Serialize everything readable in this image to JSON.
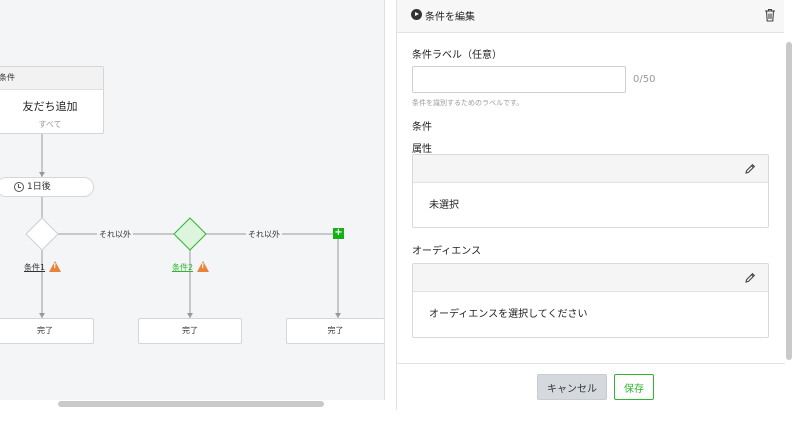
{
  "flow": {
    "trigger_header": "条件",
    "trigger_title": "友だち追加",
    "trigger_sub": "すべて",
    "delay_label": "1日後",
    "else_label_1": "それ以外",
    "else_label_2": "それ以外",
    "condition_1": "条件1",
    "condition_2": "条件2",
    "done_1": "完了",
    "done_2": "完了",
    "done_3": "完了",
    "plus_symbol": "+"
  },
  "panel": {
    "title": "条件を編集",
    "label_field_title": "条件ラベル（任意）",
    "label_value": "",
    "label_counter": "0/50",
    "label_hint": "条件を識別するためのラベルです。",
    "section_conditions": "条件",
    "attribute_title": "属性",
    "attribute_value": "未選択",
    "audience_title": "オーディエンス",
    "audience_value": "オーディエンスを選択してください",
    "cancel_label": "キャンセル",
    "save_label": "保存"
  },
  "colors": {
    "accent_green": "#2fb52f",
    "warning_orange": "#e8833a"
  }
}
